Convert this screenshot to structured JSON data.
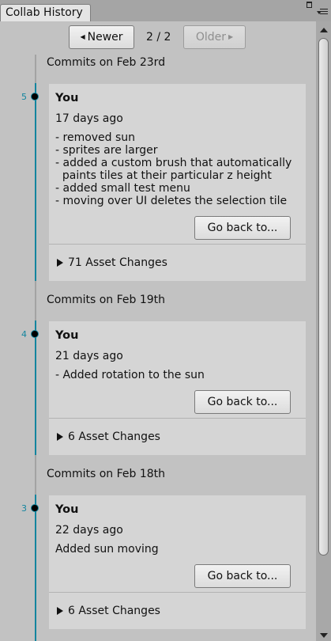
{
  "window": {
    "tab_title": "Collab History"
  },
  "icons": {
    "maximize": "maximize-icon",
    "menu": "menu-icon"
  },
  "pager": {
    "newer_label": "Newer",
    "older_label": "Older",
    "page": "2 / 2"
  },
  "colors": {
    "timeline": "#13859e",
    "background": "#c2c2c2",
    "card": "#d5d5d5"
  },
  "sections": [
    {
      "header": "Commits on Feb 23rd",
      "commit": {
        "number": "5",
        "author": "You",
        "time": "17 days ago",
        "message": "- removed sun\n- sprites are larger\n- added a custom brush that automatically\n  paints tiles at their particular z height\n- added small test menu\n- moving over UI deletes the selection tile",
        "go_back_label": "Go back to...",
        "asset_changes": "71 Asset Changes"
      }
    },
    {
      "header": "Commits on Feb 19th",
      "commit": {
        "number": "4",
        "author": "You",
        "time": "21 days ago",
        "message": "- Added rotation to the sun",
        "go_back_label": "Go back to...",
        "asset_changes": "6 Asset Changes"
      }
    },
    {
      "header": "Commits on Feb 18th",
      "commit": {
        "number": "3",
        "author": "You",
        "time": "22 days ago",
        "message": "Added sun moving",
        "go_back_label": "Go back to...",
        "asset_changes": "6 Asset Changes"
      }
    }
  ]
}
